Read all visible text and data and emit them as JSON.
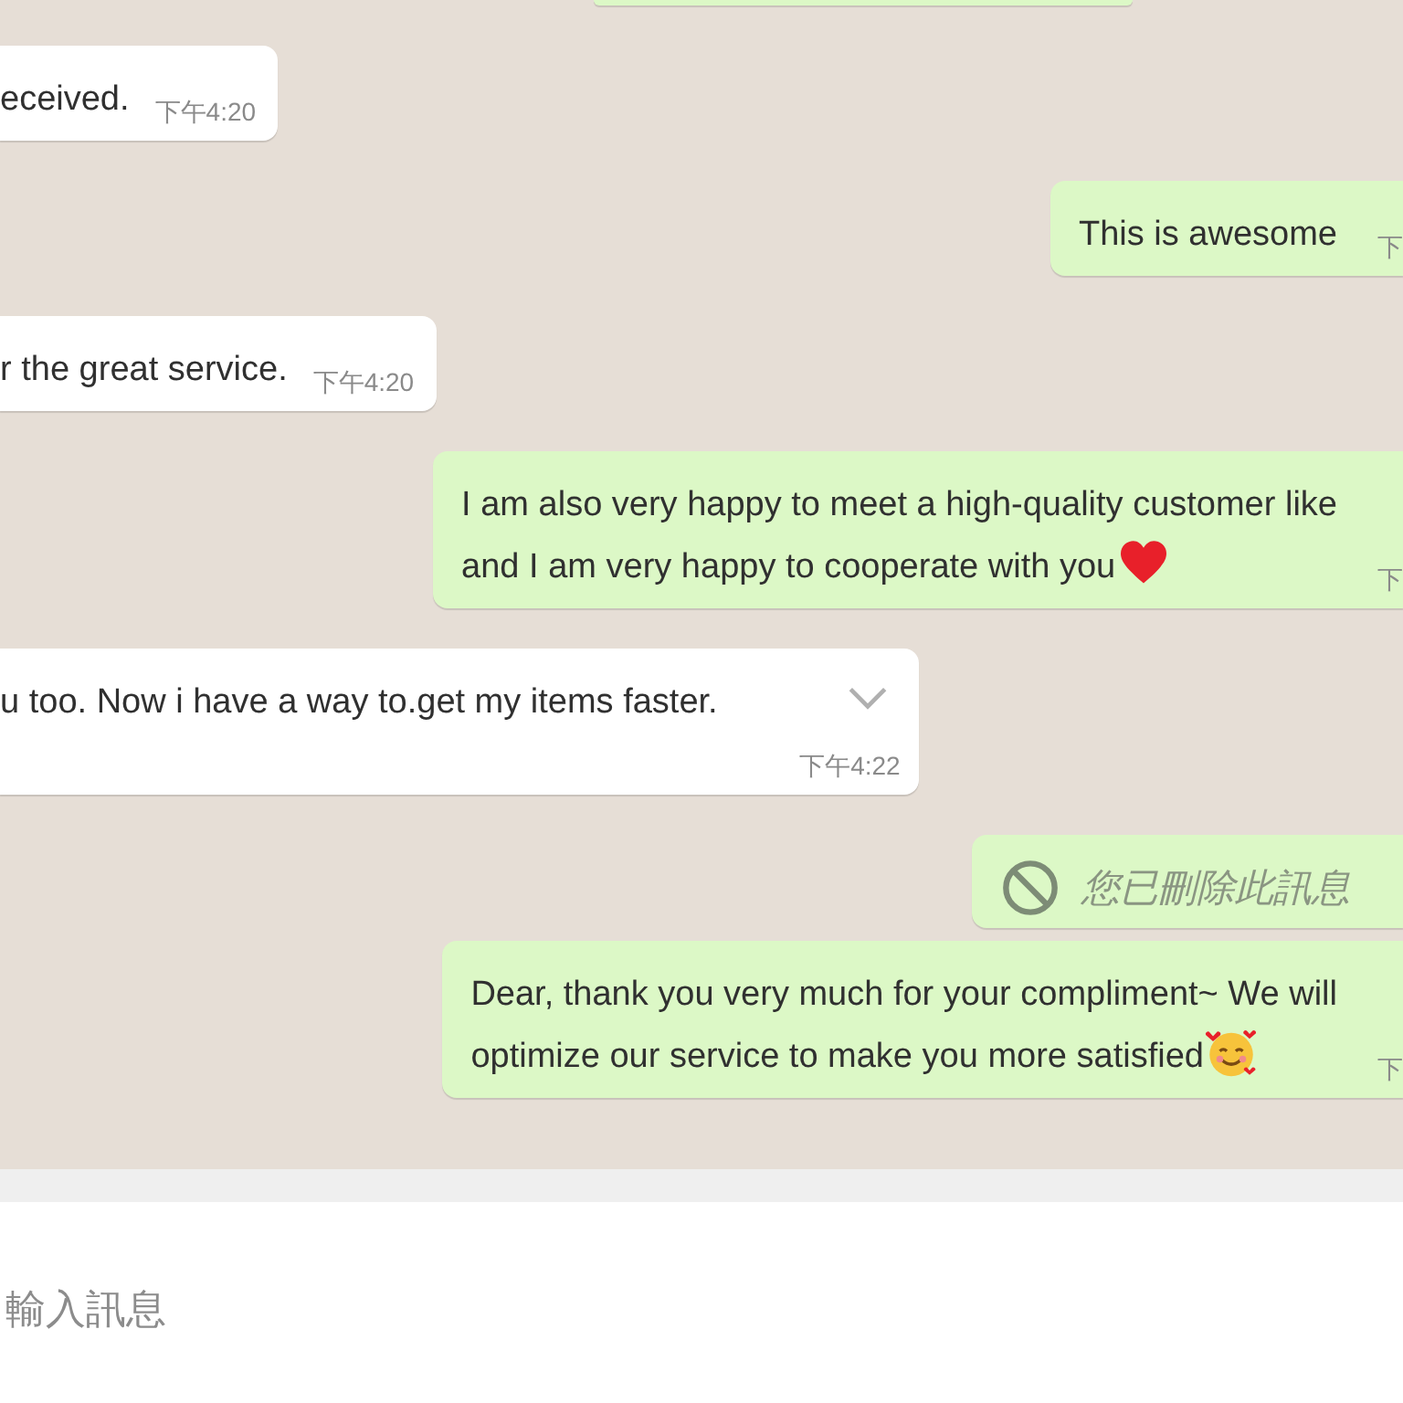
{
  "messages": [
    {
      "kind": "fragment"
    },
    {
      "kind": "incoming",
      "text": "eceived.",
      "time": "下午4:20"
    },
    {
      "kind": "outgoing",
      "text": "This is awesome",
      "time": "下"
    },
    {
      "kind": "incoming",
      "text": "r the great service.",
      "time": "下午4:20"
    },
    {
      "kind": "outgoing",
      "text": "I am also very happy to meet a high-quality customer like\nand I am very happy to cooperate with you",
      "emoji": {
        "kind": "heart"
      },
      "time": "下"
    },
    {
      "kind": "incoming",
      "text": "u too. Now i have a way to.get my items faster.",
      "time": "下午4:22",
      "menu": true
    },
    {
      "kind": "deleted",
      "text": "您已刪除此訊息"
    },
    {
      "kind": "outgoing",
      "text": "Dear, thank you very much for your compliment~ We will\noptimize our service to make you more satisfied",
      "emoji": {
        "kind": "smile-hearts"
      },
      "time": "下"
    }
  ],
  "composer": {
    "placeholder": "輸入訊息"
  }
}
